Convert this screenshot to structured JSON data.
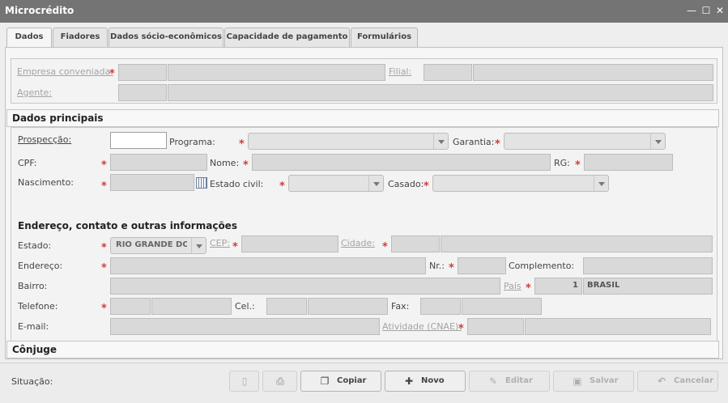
{
  "window": {
    "title": "Microcrédito",
    "minimize": "—",
    "maximize": "☐",
    "close": "✕"
  },
  "tabs": [
    {
      "label": "Dados"
    },
    {
      "label": "Fiadores"
    },
    {
      "label": "Dados sócio-econômicos"
    },
    {
      "label": "Capacidade de pagamento"
    },
    {
      "label": "Formulários"
    }
  ],
  "top": {
    "empresa": "Empresa conveniada:",
    "filial": "Filial:",
    "agente": "Agente:"
  },
  "dados_principais": {
    "title": "Dados principais",
    "prospeccao": "Prospecção:",
    "programa": "Programa:",
    "garantia": "Garantia:",
    "cpf": "CPF:",
    "nome": "Nome:",
    "rg": "RG:",
    "nascimento": "Nascimento:",
    "estado_civil": "Estado civil:",
    "casado": "Casado:"
  },
  "endereco": {
    "title": "Endereço, contato e outras informações",
    "estado": "Estado:",
    "estado_value": "RIO GRANDE DO SUL",
    "cep": "CEP:",
    "cidade": "Cidade:",
    "endereco": "Endereço:",
    "nr": "Nr.:",
    "complemento": "Complemento:",
    "bairro": "Bairro:",
    "pais": "País",
    "pais_code": "1",
    "pais_name": "BRASIL",
    "telefone": "Telefone:",
    "cel": "Cel.:",
    "fax": "Fax:",
    "email": "E-mail:",
    "atividade": "Atividade (CNAE):"
  },
  "conjuge": {
    "title": "Cônjuge"
  },
  "bottom": {
    "situacao": "Situação:",
    "copiar": "Copiar",
    "novo": "Novo",
    "editar": "Editar",
    "salvar": "Salvar",
    "cancelar": "Cancelar"
  },
  "colors": {
    "titlebar": "#747474",
    "required": "#d23b3b"
  }
}
